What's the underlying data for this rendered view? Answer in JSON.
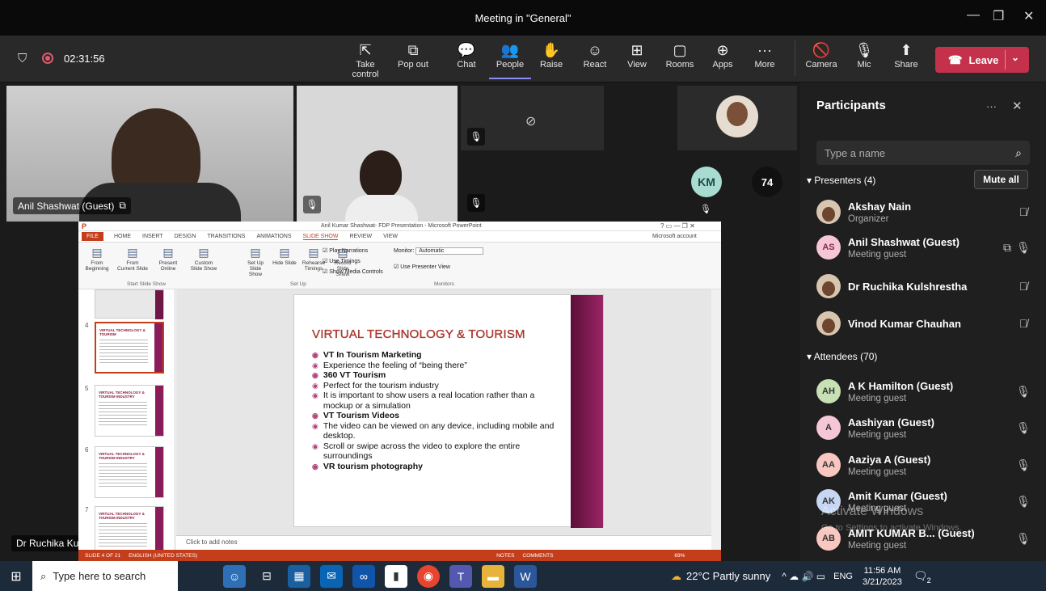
{
  "window": {
    "title": "Meeting in \"General\""
  },
  "toolbar": {
    "timer": "02:31:56",
    "buttons": [
      {
        "label": "Take control",
        "icon": "take-control-icon",
        "glyph": "⇱"
      },
      {
        "label": "Pop out",
        "icon": "pop-out-icon",
        "glyph": "⧉"
      },
      {
        "label": "Chat",
        "icon": "chat-icon",
        "glyph": "💬"
      },
      {
        "label": "People",
        "icon": "people-icon",
        "glyph": "👥"
      },
      {
        "label": "Raise",
        "icon": "raise-hand-icon",
        "glyph": "✋"
      },
      {
        "label": "React",
        "icon": "react-icon",
        "glyph": "☺"
      },
      {
        "label": "View",
        "icon": "view-icon",
        "glyph": "⊞"
      },
      {
        "label": "Rooms",
        "icon": "rooms-icon",
        "glyph": "▢"
      },
      {
        "label": "Apps",
        "icon": "apps-icon",
        "glyph": "⊕"
      },
      {
        "label": "More",
        "icon": "more-icon",
        "glyph": "···"
      }
    ],
    "camera_label": "Camera",
    "mic_label": "Mic",
    "share_label": "Share",
    "leave_label": "Leave",
    "accent": "#8b8cf5",
    "leave_color": "#c4314b"
  },
  "stage": {
    "speaker1_name": "Anil Shashwat (Guest)",
    "bottom_name": "Dr Ruchika Kulshrestha",
    "km_initials": "KM",
    "overflow_count": "74"
  },
  "ppt": {
    "title": "Anil Kumar Shashwat- FDP Presentation - Microsoft PowerPoint",
    "account": "Microsoft account",
    "tabs": [
      "FILE",
      "HOME",
      "INSERT",
      "DESIGN",
      "TRANSITIONS",
      "ANIMATIONS",
      "SLIDE SHOW",
      "REVIEW",
      "VIEW"
    ],
    "ribbon_buttons": [
      "From Beginning",
      "From Current Slide",
      "Present Online",
      "Custom Slide Show",
      "Set Up Slide Show",
      "Hide Slide",
      "Rehearse Timings",
      "Record Slide Show"
    ],
    "checks": [
      "Play Narrations",
      "Use Timings",
      "Show Media Controls"
    ],
    "monitor_label": "Monitor:",
    "monitor_value": "Automatic",
    "presenter_view": "Use Presenter View",
    "groups": [
      "Start Slide Show",
      "Set Up",
      "Monitors"
    ],
    "slide_numbers": [
      "4",
      "5",
      "6",
      "7"
    ],
    "thumb_titles": [
      "VIRTUAL TECHNOLOGY & TOURISM",
      "VIRTUAL TECHNOLOGY & TOURISM INDUSTRY",
      "VIRTUAL TECHNOLOGY & TOURISM INDUSTRY",
      "VIRTUAL TECHNOLOGY & TOURISM INDUSTRY"
    ],
    "slide_title": "VIRTUAL TECHNOLOGY & TOURISM",
    "bullets": [
      {
        "text": "VT In Tourism Marketing",
        "bold": true
      },
      {
        "text": "Experience the feeling of “being there”",
        "bold": false
      },
      {
        "text": "360 VT Tourism",
        "bold": true
      },
      {
        "text": "Perfect for the tourism industry",
        "bold": false
      },
      {
        "text": "It is important to show users a real location rather than a mockup or a simulation",
        "bold": false
      },
      {
        "text": "VT Tourism Videos",
        "bold": true
      },
      {
        "text": "The video can be viewed on any device, including mobile and desktop.",
        "bold": false
      },
      {
        "text": "Scroll or swipe across the video to explore the entire surroundings",
        "bold": false
      },
      {
        "text": "VR tourism photography",
        "bold": true
      }
    ],
    "notes_placeholder": "Click to add notes",
    "status_left": "SLIDE 4 OF 21",
    "status_lang": "ENGLISH (UNITED STATES)",
    "status_notes": "NOTES",
    "status_comments": "COMMENTS",
    "zoom": "69%"
  },
  "panel": {
    "title": "Participants",
    "search_placeholder": "Type a name",
    "presenters_header": "Presenters (4)",
    "mute_all": "Mute all",
    "attendees_header": "Attendees (70)",
    "presenters": [
      {
        "name": "Akshay Nain",
        "role": "Organizer",
        "initials": "",
        "photo": true,
        "mic": "muted"
      },
      {
        "name": "Anil Shashwat (Guest)",
        "role": "Meeting guest",
        "initials": "AS",
        "photo": false,
        "mic": "on"
      },
      {
        "name": "Dr Ruchika Kulshrestha",
        "role": "",
        "initials": "",
        "photo": true,
        "mic": "muted"
      },
      {
        "name": "Vinod Kumar Chauhan",
        "role": "",
        "initials": "",
        "photo": true,
        "mic": "muted"
      }
    ],
    "attendees": [
      {
        "name": "A K Hamilton (Guest)",
        "role": "Meeting guest",
        "initials": "AH",
        "color": "#c7e0b4"
      },
      {
        "name": "Aashiyan (Guest)",
        "role": "Meeting guest",
        "initials": "A",
        "color": "#f4c6d6"
      },
      {
        "name": "Aaziya A (Guest)",
        "role": "Meeting guest",
        "initials": "AA",
        "color": "#f7c7c0"
      },
      {
        "name": "Amit Kumar (Guest)",
        "role": "Meeting guest",
        "initials": "AK",
        "color": "#c6d6f3"
      },
      {
        "name": "AMIT KUMAR B... (Guest)",
        "role": "Meeting guest",
        "initials": "AB",
        "color": "#f7c7c0"
      }
    ],
    "watermark_1": "Activate Windows",
    "watermark_2": "Go to Settings to activate Windows."
  },
  "taskbar": {
    "search_placeholder": "Type here to search",
    "weather": "22°C  Partly sunny",
    "lang": "ENG",
    "time": "11:56 AM",
    "date": "3/21/2023",
    "notif": "2"
  }
}
